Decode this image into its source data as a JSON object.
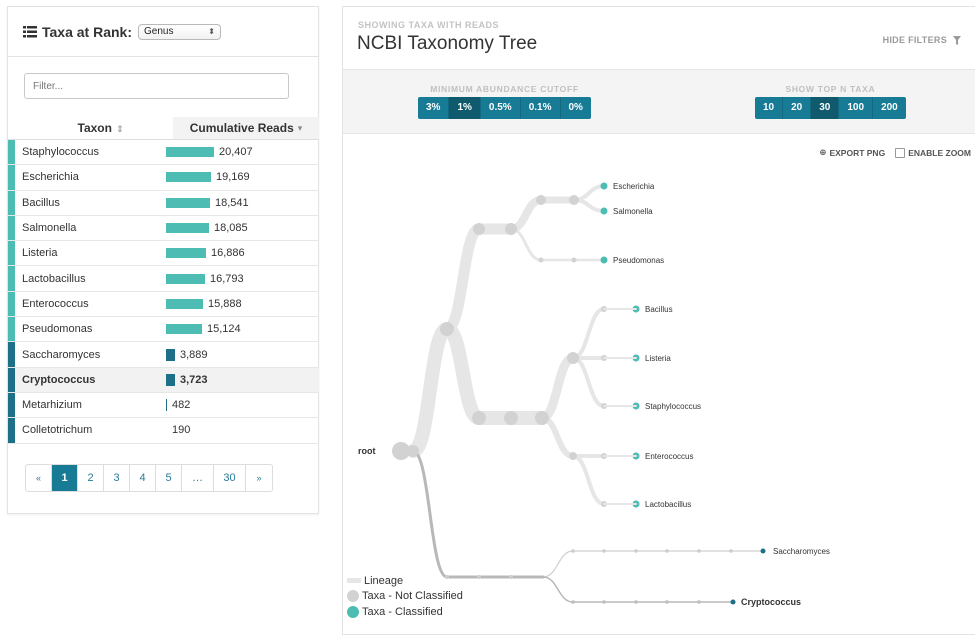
{
  "left": {
    "header_label": "Taxa at Rank:",
    "rank_value": "Genus",
    "filter_placeholder": "Filter...",
    "col_taxon": "Taxon",
    "col_reads": "Cumulative Reads",
    "sort_taxon_icon": "sort-icon",
    "sort_reads_icon": "caret-down-icon",
    "rows": [
      {
        "name": "Staphylococcus",
        "reads": "20,407",
        "value": 20407,
        "classified": true
      },
      {
        "name": "Escherichia",
        "reads": "19,169",
        "value": 19169,
        "classified": true
      },
      {
        "name": "Bacillus",
        "reads": "18,541",
        "value": 18541,
        "classified": true
      },
      {
        "name": "Salmonella",
        "reads": "18,085",
        "value": 18085,
        "classified": true
      },
      {
        "name": "Listeria",
        "reads": "16,886",
        "value": 16886,
        "classified": true
      },
      {
        "name": "Lactobacillus",
        "reads": "16,793",
        "value": 16793,
        "classified": true
      },
      {
        "name": "Enterococcus",
        "reads": "15,888",
        "value": 15888,
        "classified": true
      },
      {
        "name": "Pseudomonas",
        "reads": "15,124",
        "value": 15124,
        "classified": true
      },
      {
        "name": "Saccharomyces",
        "reads": "3,889",
        "value": 3889,
        "classified": false
      },
      {
        "name": "Cryptococcus",
        "reads": "3,723",
        "value": 3723,
        "classified": false,
        "selected": true
      },
      {
        "name": "Metarhizium",
        "reads": "482",
        "value": 482,
        "classified": false
      },
      {
        "name": "Colletotrichum",
        "reads": "190",
        "value": 190,
        "classified": false
      }
    ],
    "pagination": [
      "«",
      "1",
      "2",
      "3",
      "4",
      "5",
      "…",
      "30",
      "»"
    ],
    "current_page": "1"
  },
  "right": {
    "subtitle": "SHOWING TAXA WITH READS",
    "title": "NCBI Taxonomy Tree",
    "hide_filters": "HIDE FILTERS",
    "abundance_label": "MINIMUM ABUNDANCE CUTOFF",
    "abundance_options": [
      "3%",
      "1%",
      "0.5%",
      "0.1%",
      "0%"
    ],
    "abundance_selected": "1%",
    "topn_label": "SHOW TOP N TAXA",
    "topn_options": [
      "10",
      "20",
      "30",
      "100",
      "200"
    ],
    "topn_selected": "30",
    "export_png": "EXPORT PNG",
    "enable_zoom": "ENABLE ZOOM",
    "tree_labels": {
      "root": "root",
      "escherichia": "Escherichia",
      "salmonella": "Salmonella",
      "pseudomonas": "Pseudomonas",
      "bacillus": "Bacillus",
      "listeria": "Listeria",
      "staphylococcus": "Staphylococcus",
      "enterococcus": "Enterococcus",
      "lactobacillus": "Lactobacillus",
      "saccharomyces": "Saccharomyces",
      "cryptococcus": "Cryptococcus"
    },
    "legend": {
      "lineage": "Lineage",
      "not_classified": "Taxa - Not Classified",
      "classified": "Taxa - Classified"
    }
  },
  "colors": {
    "accent": "#177b95",
    "accent_dark": "#0f5a6d",
    "classified": "#4dbdb3",
    "unclassified_bar": "#1e7089",
    "lineage": "#e6e6e6",
    "lineage_dark": "#b8b8b8",
    "node_gray": "#d2d2d2"
  }
}
